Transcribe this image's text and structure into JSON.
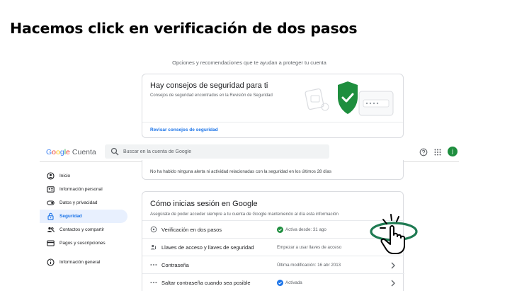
{
  "headline": "Hacemos click en verificación de dos pasos",
  "security_page": {
    "subtitle": "Opciones y recomendaciones que te ayudan a proteger tu cuenta",
    "tips_card": {
      "title": "Hay consejos de seguridad para ti",
      "description": "Consejos de seguridad encontrados en la Revisión de Seguridad",
      "link": "Revisar consejos de seguridad"
    }
  },
  "topbar": {
    "logo_g": [
      "G",
      "o",
      "o",
      "g",
      "l",
      "e"
    ],
    "product": "Cuenta",
    "search_placeholder": "Buscar en la cuenta de Google",
    "help_icon": "help-icon",
    "apps_icon": "apps-grid-icon",
    "avatar_letter": "j"
  },
  "sidebar": {
    "items": [
      {
        "label": "Inicio",
        "icon": "home-icon",
        "active": false
      },
      {
        "label": "Información personal",
        "icon": "id-card-icon",
        "active": false
      },
      {
        "label": "Datos y privacidad",
        "icon": "toggle-icon",
        "active": false
      },
      {
        "label": "Seguridad",
        "icon": "lock-icon",
        "active": true
      },
      {
        "label": "Contactos y compartir",
        "icon": "people-icon",
        "active": false
      },
      {
        "label": "Pagos y suscripciones",
        "icon": "credit-card-icon",
        "active": false
      },
      {
        "label": "Información general",
        "icon": "info-icon",
        "active": false
      }
    ]
  },
  "alert_card": {
    "text": "No ha habido ninguna alerta ni actividad relacionadas con la seguridad en los últimos 28 días"
  },
  "signin_card": {
    "title": "Cómo inicias sesión en Google",
    "description": "Asegúrate de poder acceder siempre a tu cuenta de Google manteniendo al día esta información",
    "rows": [
      {
        "label": "Verificación en dos pasos",
        "status": "Activa desde: 31 ago",
        "icon": "two-step-icon"
      },
      {
        "label": "Llaves de acceso y llaves de seguridad",
        "status": "Empezar a usar llaves de acceso",
        "icon": "passkey-icon"
      },
      {
        "label": "Contraseña",
        "status": "Última modificación: 16 abr 2013",
        "icon": "password-icon"
      },
      {
        "label": "Saltar contraseña cuando sea posible",
        "status": "Activada",
        "icon": "skip-password-icon"
      }
    ]
  },
  "colors": {
    "accent": "#1a73e8",
    "success": "#1e8e3e",
    "annotation": "#1e7a52",
    "active_nav_bg": "#e8f0fe"
  }
}
